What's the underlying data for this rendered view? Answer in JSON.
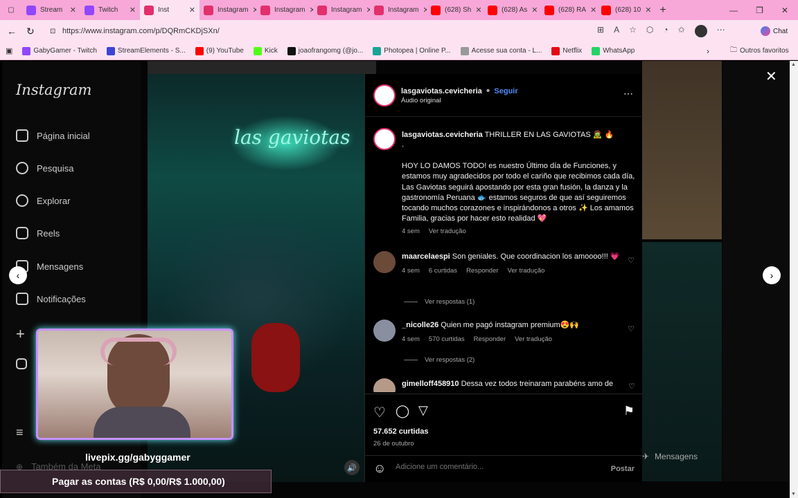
{
  "browser": {
    "tabs": [
      {
        "label": "Stream",
        "color": "#9146ff",
        "icon": "grid-icon"
      },
      {
        "label": "Twitch",
        "color": "#9146ff",
        "icon": "twitch-icon"
      },
      {
        "label": "Inst",
        "color": "#e1306c",
        "icon": "instagram-icon"
      },
      {
        "label": "Instagram",
        "color": "#e1306c",
        "icon": "instagram-icon"
      },
      {
        "label": "Instagram",
        "color": "#e1306c",
        "icon": "instagram-icon"
      },
      {
        "label": "Instagram",
        "color": "#e1306c",
        "icon": "instagram-icon"
      },
      {
        "label": "Instagram",
        "color": "#e1306c",
        "icon": "instagram-icon"
      },
      {
        "label": "(628) Sh",
        "color": "#ff0000",
        "icon": "youtube-icon"
      },
      {
        "label": "(628) As",
        "color": "#ff0000",
        "icon": "youtube-icon"
      },
      {
        "label": "(628) RA",
        "color": "#ff0000",
        "icon": "youtube-icon"
      },
      {
        "label": "(628) 10",
        "color": "#ff0000",
        "icon": "youtube-icon"
      }
    ],
    "url": "https://www.instagram.com/p/DQRmCKDjSXn/",
    "chat_label": "Chat",
    "favorites": [
      {
        "label": "GabyGamer - Twitch",
        "color": "#9146ff"
      },
      {
        "label": "StreamElements - S...",
        "color": "#3d44d4"
      },
      {
        "label": "(9) YouTube",
        "color": "#ff0000"
      },
      {
        "label": "Kick",
        "color": "#53fc18"
      },
      {
        "label": "joaofrangomg (@jo...",
        "color": "#111111"
      },
      {
        "label": "Photopea | Online P...",
        "color": "#18a497"
      },
      {
        "label": "Acesse sua conta - L...",
        "color": "#999999"
      },
      {
        "label": "Netflix",
        "color": "#e50914"
      },
      {
        "label": "WhatsApp",
        "color": "#25d366"
      }
    ],
    "other_favorites": "Outros favoritos"
  },
  "sidebar": {
    "logo": "Instagram",
    "items": [
      {
        "label": "Página inicial",
        "icon": "home-icon"
      },
      {
        "label": "Pesquisa",
        "icon": "search-icon"
      },
      {
        "label": "Explorar",
        "icon": "compass-icon"
      },
      {
        "label": "Reels",
        "icon": "reels-icon"
      },
      {
        "label": "Mensagens",
        "icon": "messenger-icon"
      },
      {
        "label": "Notificações",
        "icon": "heart-icon"
      }
    ],
    "meta_label": "Também da Meta"
  },
  "post": {
    "neon_sign": "las gaviotas",
    "author": "lasgaviotas.cevicheria",
    "follow": "Seguir",
    "audio": "Áudio original",
    "caption_title": "THRILLER EN LAS GAVIOTAS 🧟 🔥",
    "caption_dot": ".",
    "caption_body": "HOY LO DAMOS TODO! es nuestro Último día de Funciones, y estamos muy agradecidos por todo el cariño que recibimos cada día, Las Gaviotas seguirá apostando por esta gran fusión, la danza y la gastronomía Peruana 🐟 estamos seguros de que así seguiremos tocando muchos corazones e inspirándonos a otros ✨ Los amamos Familia, gracias por hacer esto realidad 💖",
    "caption_time": "4 sem",
    "see_translation": "Ver tradução",
    "comments": [
      {
        "user": "maarcelaespi",
        "text": "Son geniales. Que coordinacion los amoooo!!! 💗",
        "time": "4 sem",
        "likes": "6 curtidas",
        "reply": "Responder",
        "translate": "Ver tradução",
        "replies": "Ver respostas (1)"
      },
      {
        "user": "_nicolle26",
        "text": "Quien me pagó instagram premium😍🙌",
        "time": "4 sem",
        "likes": "570 curtidas",
        "reply": "Responder",
        "translate": "Ver tradução",
        "replies": "Ver respostas (2)"
      },
      {
        "user": "gimelloff458910",
        "text": "Dessa vez todos treinaram parabéns amo de"
      }
    ],
    "likes": "57.652 curtidas",
    "date": "26 de outubro",
    "comment_placeholder": "Adicione um comentário...",
    "post_button": "Postar"
  },
  "overlay": {
    "donation_link": "livepix.gg/gabyggamer",
    "goal": "Pagar as contas (R$ 0,00/R$ 1.000,00)",
    "bg_messages": "Mensagens"
  }
}
